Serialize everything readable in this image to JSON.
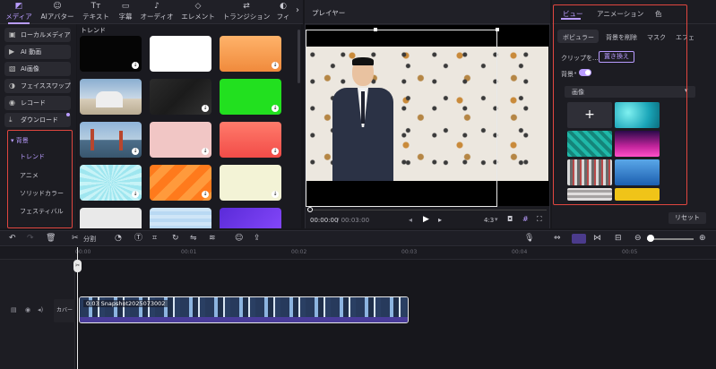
{
  "toolbar": {
    "tabs": [
      {
        "label": "メディア",
        "icon": "media-icon"
      },
      {
        "label": "AIアバター",
        "icon": "avatar-icon"
      },
      {
        "label": "テキスト",
        "icon": "text-icon"
      },
      {
        "label": "字幕",
        "icon": "caption-icon"
      },
      {
        "label": "オーディオ",
        "icon": "audio-icon"
      },
      {
        "label": "エレメント",
        "icon": "element-icon"
      },
      {
        "label": "トランジション",
        "icon": "transition-icon"
      },
      {
        "label": "フィ",
        "icon": "filter-icon"
      }
    ],
    "more": "›"
  },
  "left_nav": {
    "items": [
      "ローカルメディア",
      "AI 動画",
      "AI画像",
      "フェイススワップ",
      "レコード",
      "ダウンロード"
    ],
    "category_header": "背景",
    "categories": [
      "トレンド",
      "アニメ",
      "ソリッドカラー",
      "フェスティバル"
    ]
  },
  "grid": {
    "section_title": "トレンド"
  },
  "player": {
    "title": "プレイヤー",
    "time_current": "00:00:00",
    "time_total": "/ 00:03:00",
    "ratio": "4:3"
  },
  "right": {
    "tabs": [
      "ビュー",
      "アニメーション",
      "色"
    ],
    "subtabs": [
      "ボビュラー",
      "背景を削除",
      "マスク",
      "エフェ"
    ],
    "clip_label": "クリップを...",
    "replace_button": "置き換え",
    "background_label": "背景",
    "dropdown_value": "画像",
    "reset": "リセット",
    "add_symbol": "+"
  },
  "timeline": {
    "split_label": "分割",
    "ruler_ticks": [
      "00:00",
      "00:01",
      "00:02",
      "00:03",
      "00:04",
      "00:05"
    ],
    "cover_label": "カバー",
    "clip_label": "0:03  Snapshot2025073002"
  },
  "colors": {
    "accent": "#b99cff",
    "highlight_box": "#e0463f",
    "clip": "#3a2f78"
  }
}
